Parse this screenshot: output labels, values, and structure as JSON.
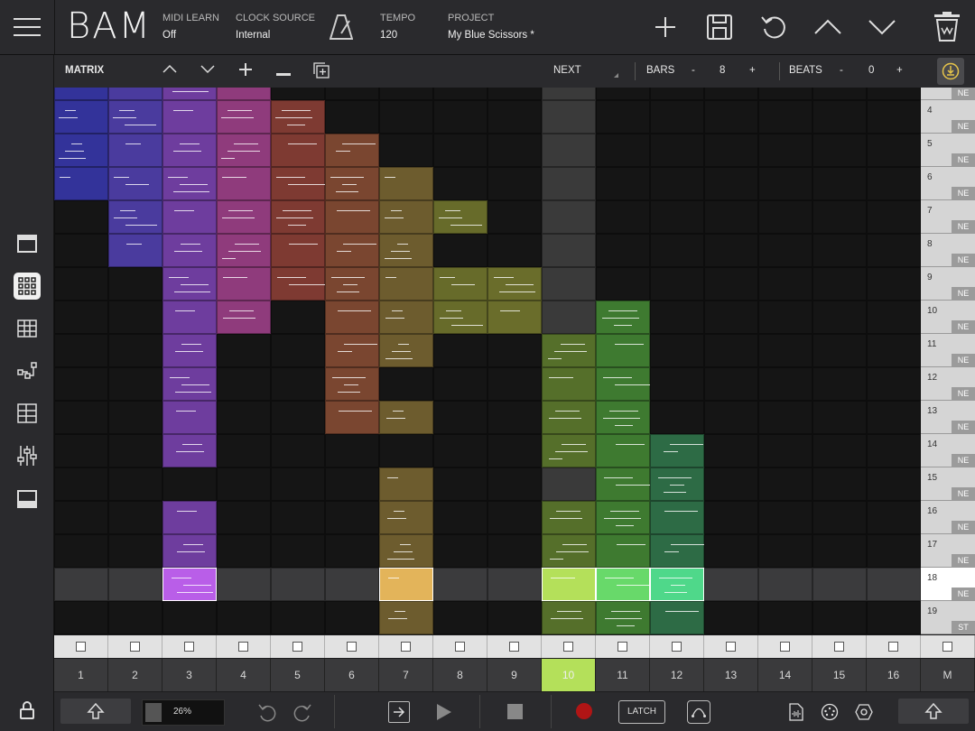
{
  "header": {
    "logo": "BAM",
    "midi_learn": {
      "label": "MIDI LEARN",
      "value": "Off"
    },
    "clock_source": {
      "label": "CLOCK SOURCE",
      "value": "Internal"
    },
    "tempo": {
      "label": "TEMPO",
      "value": "120"
    },
    "project": {
      "label": "PROJECT",
      "value": "My Blue Scissors *"
    }
  },
  "matrix_bar": {
    "title": "MATRIX",
    "next_label": "NEXT",
    "bars_label": "BARS",
    "bars_value": "8",
    "beats_label": "BEATS",
    "beats_value": "0",
    "minus": "-",
    "plus": "+"
  },
  "scenes": [
    {
      "num": "",
      "mode": "NE"
    },
    {
      "num": "4",
      "mode": "NE"
    },
    {
      "num": "5",
      "mode": "NE"
    },
    {
      "num": "6",
      "mode": "NE"
    },
    {
      "num": "7",
      "mode": "NE"
    },
    {
      "num": "8",
      "mode": "NE"
    },
    {
      "num": "9",
      "mode": "NE"
    },
    {
      "num": "10",
      "mode": "NE"
    },
    {
      "num": "11",
      "mode": "NE"
    },
    {
      "num": "12",
      "mode": "NE"
    },
    {
      "num": "13",
      "mode": "NE"
    },
    {
      "num": "14",
      "mode": "NE"
    },
    {
      "num": "15",
      "mode": "NE"
    },
    {
      "num": "16",
      "mode": "NE"
    },
    {
      "num": "17",
      "mode": "NE"
    },
    {
      "num": "18",
      "mode": "NE"
    },
    {
      "num": "19",
      "mode": "ST"
    }
  ],
  "tracks": [
    "1",
    "2",
    "3",
    "4",
    "5",
    "6",
    "7",
    "8",
    "9",
    "10",
    "11",
    "12",
    "13",
    "14",
    "15",
    "16",
    "M"
  ],
  "active_track": "10",
  "track_colors": [
    "#33339a",
    "#4a3b9e",
    "#6e3d9e",
    "#8f3b7c",
    "#7e3a32",
    "#7a4630",
    "#6d5c2e",
    "#676b2a",
    "#6a6d2b",
    "#556f2a",
    "#3e7a30",
    "#2d6b45",
    "",
    "",
    "",
    ""
  ],
  "bottom_bar": {
    "zoom": "26%",
    "latch": "LATCH"
  }
}
